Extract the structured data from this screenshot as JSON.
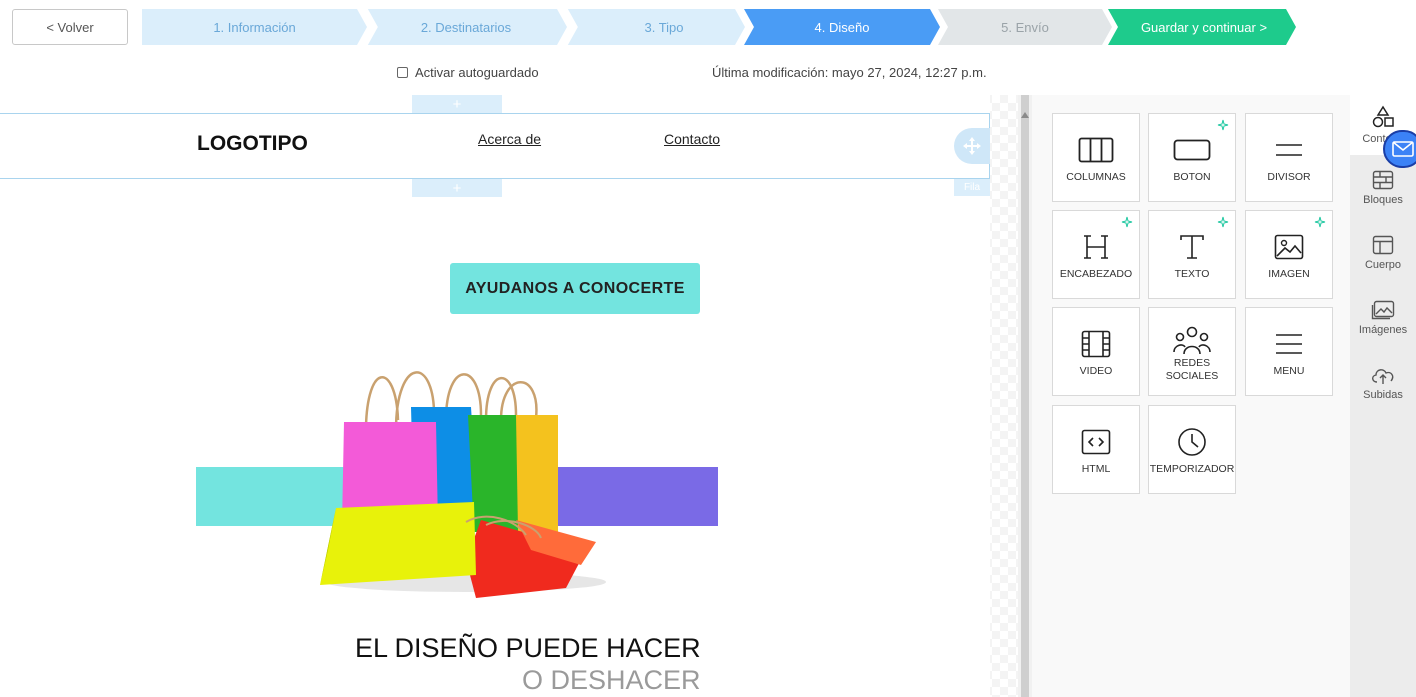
{
  "header": {
    "back_label": "< Volver",
    "steps": [
      {
        "label": "1. Información",
        "state": "done"
      },
      {
        "label": "2. Destinatarios",
        "state": "done"
      },
      {
        "label": "3. Tipo",
        "state": "done"
      },
      {
        "label": "4. Diseño",
        "state": "active"
      },
      {
        "label": "5. Envío",
        "state": "pending"
      }
    ],
    "save_label": "Guardar y continuar >",
    "colors": {
      "done": "#dbeefb",
      "done_text": "#6aa8d8",
      "active": "#4a9cf5",
      "pending": "#e2e6e8",
      "pending_text": "#9aa3a8",
      "save": "#1ecb8c"
    }
  },
  "subrow": {
    "autosave_label": "Activar autoguardado",
    "autosave_checked": false,
    "last_modified": "Última modificación: mayo 27, 2024, 12:27 p.m."
  },
  "email": {
    "add_icon": "plus-icon",
    "logo": "LOGOTIPO",
    "nav": [
      "Acerca de",
      "Contacto"
    ],
    "row_tag": "Fila",
    "cta_label": "AYUDANOS A CONOCERTE",
    "headline_line1": "EL DISEÑO PUEDE HACER",
    "headline_line2": "O DESHACER",
    "colors": {
      "cta": "#73e4df",
      "band_left": "#73e4df",
      "band_right": "#7a6ae6",
      "row_border": "#a9d4ee"
    }
  },
  "panel": {
    "tiles": [
      {
        "label": "COLUMNAS",
        "icon": "columns-icon",
        "spark": false
      },
      {
        "label": "BOTON",
        "icon": "button-icon",
        "spark": true
      },
      {
        "label": "DIVISOR",
        "icon": "divider-icon",
        "spark": false
      },
      {
        "label": "ENCABEZADO",
        "icon": "heading-icon",
        "spark": true
      },
      {
        "label": "TEXTO",
        "icon": "text-icon",
        "spark": true
      },
      {
        "label": "IMAGEN",
        "icon": "image-icon",
        "spark": true
      },
      {
        "label": "VIDEO",
        "icon": "video-icon",
        "spark": false
      },
      {
        "label": "REDES SOCIALES",
        "icon": "social-icon",
        "spark": false
      },
      {
        "label": "MENU",
        "icon": "menu-icon",
        "spark": false
      },
      {
        "label": "HTML",
        "icon": "html-icon",
        "spark": false
      },
      {
        "label": "TEMPORIZADOR",
        "icon": "timer-icon",
        "spark": false
      }
    ],
    "spark_color": "#1ec7a0"
  },
  "sidebar": {
    "tabs": [
      {
        "label": "Conte",
        "icon": "shapes-icon",
        "active": true
      },
      {
        "label": "Bloques",
        "icon": "blocks-icon",
        "active": false
      },
      {
        "label": "Cuerpo",
        "icon": "layout-icon",
        "active": false
      },
      {
        "label": "Imágenes",
        "icon": "images-icon",
        "active": false
      },
      {
        "label": "Subidas",
        "icon": "cloud-upload-icon",
        "active": false
      }
    ]
  }
}
